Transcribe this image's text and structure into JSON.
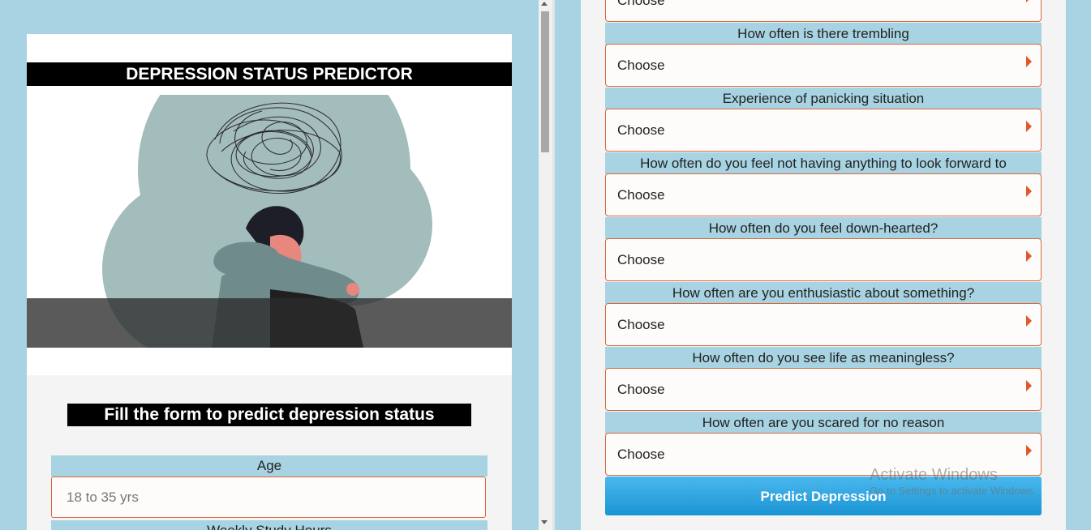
{
  "left": {
    "app_title": "DEPRESSION STATUS PREDICTOR",
    "illustration_icon": "person-hugging-knees-illustration",
    "form_heading": "Fill the form to predict depression status",
    "age_label": "Age",
    "age_placeholder": "18 to 35 yrs",
    "next_label": "Weekly Study Hours"
  },
  "right": {
    "top_select_value": "Choose",
    "questions": [
      {
        "label": "How often is there trembling",
        "value": "Choose"
      },
      {
        "label": "Experience of panicking situation",
        "value": "Choose"
      },
      {
        "label": "How often do you feel not having anything to look forward to",
        "value": "Choose"
      },
      {
        "label": "How often do you feel down-hearted?",
        "value": "Choose"
      },
      {
        "label": "How often are you enthusiastic about something?",
        "value": "Choose"
      },
      {
        "label": "How often do you see life as meaningless?",
        "value": "Choose"
      },
      {
        "label": "How often are you scared for no reason",
        "value": "Choose"
      }
    ],
    "predict_button": "Predict Depression"
  },
  "watermark": {
    "title": "Activate Windows",
    "subtitle": "Go to Settings to activate Windows."
  },
  "colors": {
    "page_background": "#a8d3e2",
    "input_border": "#d9683a",
    "select_arrow": "#e0582a",
    "button_blue": "#1b94d4"
  }
}
